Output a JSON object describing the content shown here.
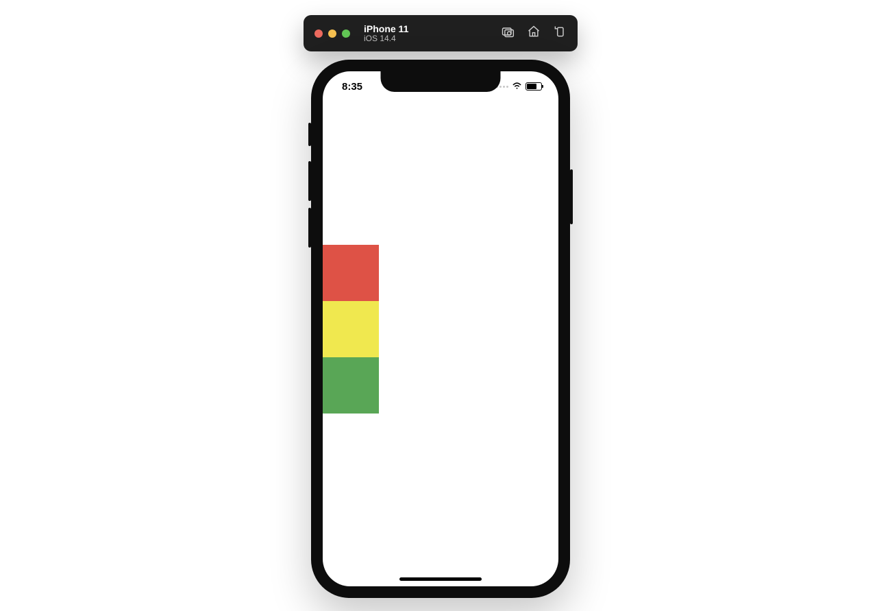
{
  "simulator": {
    "device_name": "iPhone 11",
    "os_version": "iOS 14.4",
    "toolbar": {
      "screenshot": "screenshot-icon",
      "home": "home-icon",
      "rotate": "rotate-icon"
    }
  },
  "status_bar": {
    "time": "8:35"
  },
  "app": {
    "blocks": [
      {
        "name": "red-block",
        "color": "#de5246"
      },
      {
        "name": "yellow-block",
        "color": "#f0e84f"
      },
      {
        "name": "green-block",
        "color": "#59a656"
      }
    ]
  }
}
